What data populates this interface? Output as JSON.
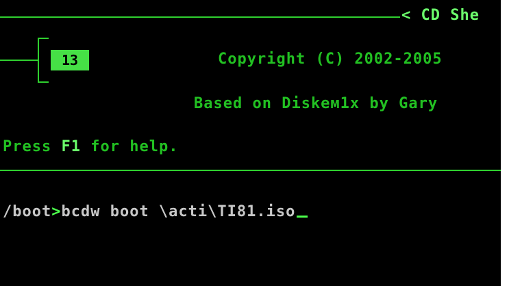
{
  "header": {
    "title_fragment": "< CD She",
    "session_number": "13",
    "copyright": "Copyright (C) 2002-2005",
    "based_on": "Based on Diskем1х by Gary"
  },
  "help_line": {
    "prefix": "Press ",
    "key": "F1",
    "suffix": " for help."
  },
  "command_line": {
    "path": "/boot",
    "prompt_symbol": ">",
    "command": "bcdw boot \\acti\\TI81.iso"
  },
  "colors": {
    "background": "#000000",
    "text_green": "#22c022",
    "highlight_green": "#6cff6c",
    "command_text": "#c8c8c8"
  }
}
